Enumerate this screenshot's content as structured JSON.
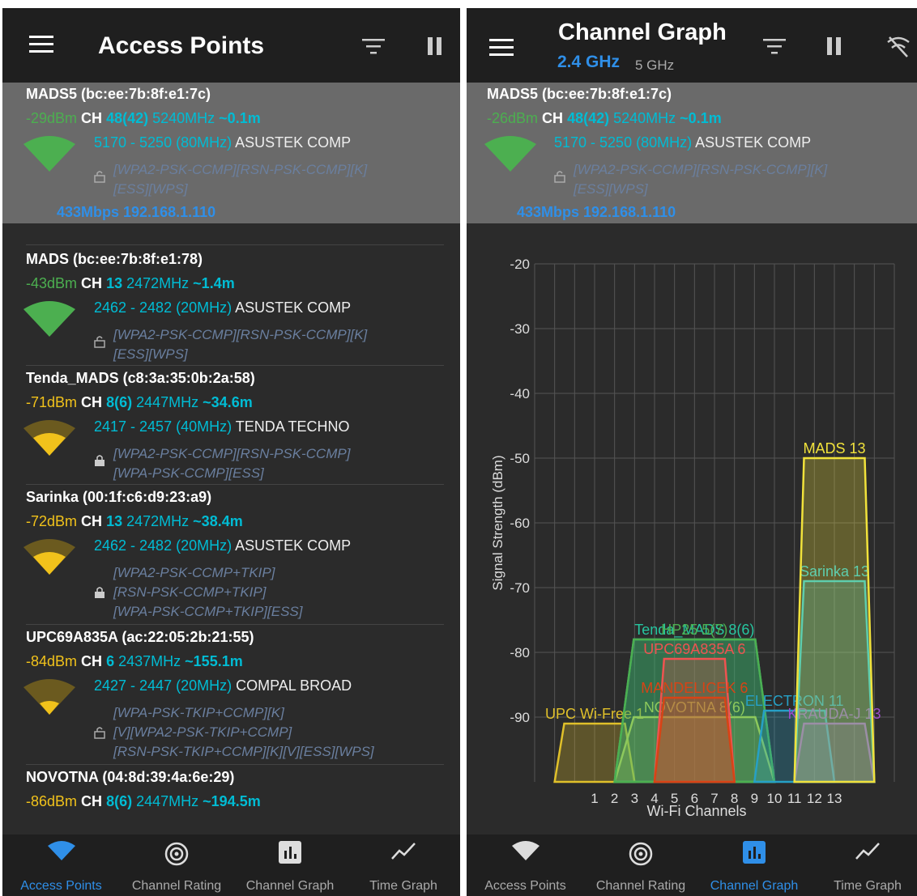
{
  "left": {
    "title": "Access Points",
    "nav": [
      {
        "label": "Access Points",
        "icon": "wifi-icon",
        "active": true
      },
      {
        "label": "Channel Rating",
        "icon": "radar-icon",
        "active": false
      },
      {
        "label": "Channel Graph",
        "icon": "bar-chart-icon",
        "active": false
      },
      {
        "label": "Time Graph",
        "icon": "line-graph-icon",
        "active": false
      }
    ],
    "access_points": [
      {
        "name": "MADS5 (bc:ee:7b:8f:e1:7c)",
        "dbm": "-29dBm",
        "ch_label": "CH",
        "channel": "48(42)",
        "freq": "5240MHz",
        "dist": "~0.1m",
        "range": "5170 - 5250 (80MHz)",
        "vendor": "ASUSTEK COMP",
        "cap1": "[WPA2-PSK-CCMP][RSN-PSK-CCMP][K]",
        "cap2": "[ESS][WPS]",
        "rate": "433Mbps 192.168.1.110",
        "signal": "green"
      },
      {
        "name": "MADS (bc:ee:7b:8f:e1:78)",
        "dbm": "-43dBm",
        "ch_label": "CH",
        "channel": "13",
        "freq": "2472MHz",
        "dist": "~1.4m",
        "range": "2462 - 2482 (20MHz)",
        "vendor": "ASUSTEK COMP",
        "cap1": "[WPA2-PSK-CCMP][RSN-PSK-CCMP][K]",
        "cap2": "[ESS][WPS]",
        "signal": "green"
      },
      {
        "name": "Tenda_MADS (c8:3a:35:0b:2a:58)",
        "dbm": "-71dBm",
        "ch_label": "CH",
        "channel": "8(6)",
        "freq": "2447MHz",
        "dist": "~34.6m",
        "range": "2417 - 2457 (40MHz)",
        "vendor": "TENDA TECHNO",
        "cap1": "[WPA2-PSK-CCMP][RSN-PSK-CCMP]",
        "cap2": "[WPA-PSK-CCMP][ESS]",
        "signal": "yellow"
      },
      {
        "name": "Sarinka (00:1f:c6:d9:23:a9)",
        "dbm": "-72dBm",
        "ch_label": "CH",
        "channel": "13",
        "freq": "2472MHz",
        "dist": "~38.4m",
        "range": "2462 - 2482 (20MHz)",
        "vendor": "ASUSTEK COMP",
        "cap1": "[WPA2-PSK-CCMP+TKIP]",
        "cap2": "[RSN-PSK-CCMP+TKIP]",
        "cap3": "[WPA-PSK-CCMP+TKIP][ESS]",
        "signal": "yellow"
      },
      {
        "name": "UPC69A835A (ac:22:05:2b:21:55)",
        "dbm": "-84dBm",
        "ch_label": "CH",
        "channel": "6",
        "freq": "2437MHz",
        "dist": "~155.1m",
        "range": "2427 - 2447 (20MHz)",
        "vendor": "COMPAL BROAD",
        "cap1": "[WPA-PSK-TKIP+CCMP][K]",
        "cap2": "[V][WPA2-PSK-TKIP+CCMP]",
        "cap3": "[RSN-PSK-TKIP+CCMP][K][V][ESS][WPS]",
        "signal": "yellow"
      },
      {
        "name": "NOVOTNA (04:8d:39:4a:6e:29)",
        "dbm": "-86dBm",
        "ch_label": "CH",
        "channel": "8(6)",
        "freq": "2447MHz",
        "dist": "~194.5m"
      }
    ]
  },
  "right": {
    "title": "Channel Graph",
    "band_24": "2.4 GHz",
    "band_5": "5 GHz",
    "nav": [
      {
        "label": "Access Points",
        "icon": "wifi-icon",
        "active": false
      },
      {
        "label": "Channel Rating",
        "icon": "radar-icon",
        "active": false
      },
      {
        "label": "Channel Graph",
        "icon": "bar-chart-icon",
        "active": true
      },
      {
        "label": "Time Graph",
        "icon": "line-graph-icon",
        "active": false
      }
    ],
    "selected_ap": {
      "name": "MADS5 (bc:ee:7b:8f:e1:7c)",
      "dbm": "-26dBm",
      "ch_label": "CH",
      "channel": "48(42)",
      "freq": "5240MHz",
      "dist": "~0.1m",
      "range": "5170 - 5250 (80MHz)",
      "vendor": "ASUSTEK COMP",
      "cap1": "[WPA2-PSK-CCMP][RSN-PSK-CCMP][K]",
      "cap2": "[ESS][WPS]",
      "rate": "433Mbps 192.168.1.110"
    }
  },
  "chart_data": {
    "type": "area",
    "xlabel": "Wi-Fi Channels",
    "ylabel": "Signal Strength (dBm)",
    "x_ticks": [
      "1",
      "2",
      "3",
      "4",
      "5",
      "6",
      "7",
      "8",
      "9",
      "10",
      "11",
      "12",
      "13"
    ],
    "y_ticks": [
      "-20",
      "-30",
      "-40",
      "-50",
      "-60",
      "-70",
      "-80",
      "-90"
    ],
    "ylim": [
      -100,
      -20
    ],
    "xlim": [
      -2,
      16
    ],
    "grid": true,
    "series": [
      {
        "name": "UPC Wi-Free 1",
        "label": "UPC Wi-Free 1",
        "channel": 1,
        "width": 20,
        "dbm": -91,
        "color": "#e0c02a"
      },
      {
        "name": "NOVOTNA 8(6)",
        "label": "NOVOTNA 8(6)",
        "channel": 6,
        "width": 40,
        "dbm": -90,
        "color": "#d9d94a"
      },
      {
        "name": "Tenda_MADS 8(6)",
        "label": "Tenda_MADS 8(6)",
        "channel": 6,
        "width": 40,
        "dbm": -78,
        "color": "#26c6a0"
      },
      {
        "name": "HP25 5(7)",
        "label": "HP25 5(7)",
        "channel": 6,
        "width": 40,
        "dbm": -78,
        "color": "#4caf50"
      },
      {
        "name": "UPC69A835A 6",
        "label": "UPC69A835A 6",
        "channel": 6,
        "width": 20,
        "dbm": -81,
        "color": "#ef5350"
      },
      {
        "name": "MANDELICEK 6",
        "label": "MANDELICEK 6",
        "channel": 6,
        "width": 20,
        "dbm": -87,
        "color": "#d84315"
      },
      {
        "name": "ELECTRON 11",
        "label": "ELECTRON 11",
        "channel": 11,
        "width": 20,
        "dbm": -89,
        "color": "#26a0c6"
      },
      {
        "name": "KRAUDA-J 13",
        "label": "KRAUDA-J 13",
        "channel": 13,
        "width": 20,
        "dbm": -91,
        "color": "#9c4dcc"
      },
      {
        "name": "Sarinka 13",
        "label": "Sarinka 13",
        "channel": 13,
        "width": 20,
        "dbm": -69,
        "color": "#26c6da"
      },
      {
        "name": "MADS 13",
        "label": "MADS 13",
        "channel": 13,
        "width": 20,
        "dbm": -50,
        "color": "#f1e23b"
      }
    ]
  },
  "colors": {
    "accent": "#2f8fe8",
    "cyan": "#00bcd4",
    "green": "#4caf50",
    "yellow": "#f1c21b",
    "bg": "#2b2b2b",
    "bar": "#1f1f1f"
  }
}
